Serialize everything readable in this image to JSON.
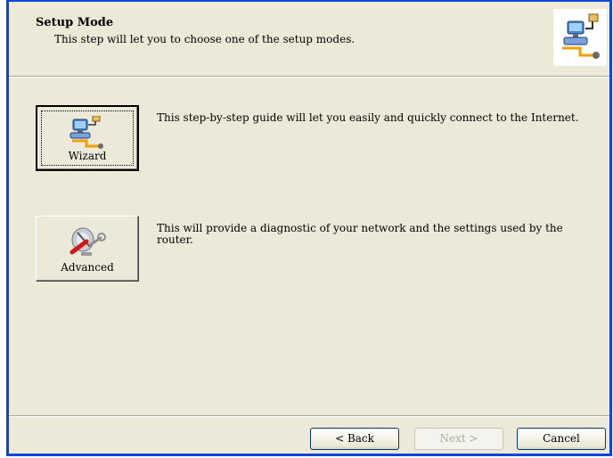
{
  "header": {
    "title": "Setup Mode",
    "subtitle": "This step will let you to choose one of the setup modes.",
    "icon": "network-wizard-icon"
  },
  "options": [
    {
      "button_label": "Wizard",
      "icon": "network-wizard-icon",
      "description": "This step-by-step guide will let you easily and quickly connect to the Internet."
    },
    {
      "button_label": "Advanced",
      "icon": "satellite-dish-tools-icon",
      "description": "This will provide a diagnostic of your network and the settings used by the router."
    }
  ],
  "footer": {
    "back_label": "< Back",
    "next_label": "Next >",
    "cancel_label": "Cancel",
    "next_enabled": false
  },
  "colors": {
    "window_border": "#0a46d8",
    "dialog_bg": "#ece9d8"
  }
}
